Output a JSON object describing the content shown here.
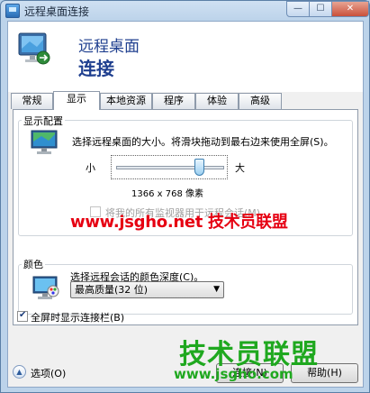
{
  "window": {
    "title": "远程桌面连接",
    "min_glyph": "—",
    "max_glyph": "☐",
    "close_glyph": "✕"
  },
  "banner": {
    "line1": "远程桌面",
    "line2": "连接",
    "icon": "remote-desktop-monitor-icon"
  },
  "tabs": [
    {
      "label": "常规",
      "active": false
    },
    {
      "label": "显示",
      "active": true
    },
    {
      "label": "本地资源",
      "active": false
    },
    {
      "label": "程序",
      "active": false
    },
    {
      "label": "体验",
      "active": false
    },
    {
      "label": "高级",
      "active": false
    }
  ],
  "display_config": {
    "group_label": "显示配置",
    "instruction": "选择远程桌面的大小。将滑块拖动到最右边来使用全屏(S)。",
    "slider_min_label": "小",
    "slider_max_label": "大",
    "slider_level": 0.8,
    "resolution": "1366 x 768 像素",
    "use_all_monitors_label": "将我的所有监视器用于远程会话(M)",
    "use_all_monitors_checked": false,
    "use_all_monitors_enabled": false
  },
  "color": {
    "group_label": "颜色",
    "instruction": "选择远程会话的颜色深度(C)。",
    "selected_depth": "最高质量(32 位)",
    "chevron": "▼"
  },
  "fullscreen_bar": {
    "label": "全屏时显示连接栏(B)",
    "checked": true
  },
  "footer": {
    "options_label": "选项(O)",
    "options_glyph": "▲",
    "connect_label": "连接(N)",
    "help_label": "帮助(H)"
  },
  "watermarks": {
    "red": "www.jsgho.net 技术员联盟",
    "green_big": "技术员联盟",
    "green_small": "www.jsgho.com"
  },
  "colors": {
    "banner_text": "#1f3f8f",
    "watermark_red": "#e60012",
    "watermark_green": "#1fa81f",
    "window_frame": "#bcd3ea"
  }
}
